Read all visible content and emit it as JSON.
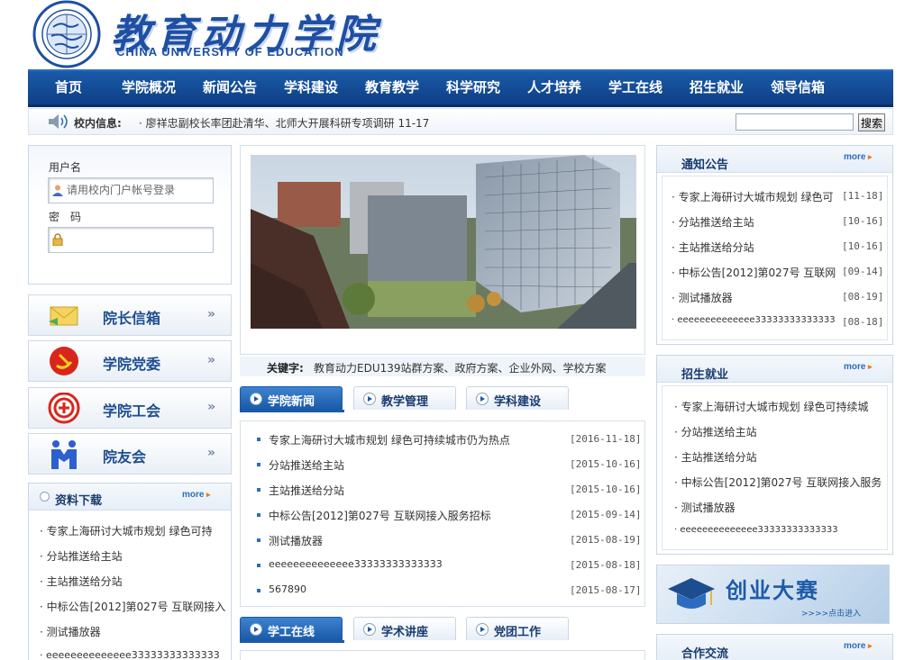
{
  "header": {
    "logo_cn": "教育动力学院",
    "logo_en": "CHINA UNIVERSITY OF EDUCATION"
  },
  "nav": {
    "items": [
      "首页",
      "学院概况",
      "新闻公告",
      "学科建设",
      "教育教学",
      "科学研究",
      "人才培养",
      "学工在线",
      "招生就业",
      "领导信箱"
    ]
  },
  "infobar": {
    "label": "校内信息:",
    "text": "· 廖祥忠副校长率团赴清华、北师大开展科研专项调研 11-17",
    "search_value": "",
    "search_button": "搜索"
  },
  "login": {
    "username_label": "用户名",
    "username_placeholder": "请用校内门户帐号登录",
    "password_label": "密　码"
  },
  "side_buttons": [
    {
      "label": "院长信箱",
      "icon": "mail-icon"
    },
    {
      "label": "学院党委",
      "icon": "party-emblem-icon"
    },
    {
      "label": "学院工会",
      "icon": "union-emblem-icon"
    },
    {
      "label": "院友会",
      "icon": "handshake-icon"
    }
  ],
  "downloads": {
    "title": "资料下载",
    "more": "more",
    "items": [
      "专家上海研讨大城市规划 绿色可持",
      "分站推送给主站",
      "主站推送给分站",
      "中标公告[2012]第027号 互联网接入",
      "测试播放器",
      "eeeeeeeeeeeeee33333333333333"
    ]
  },
  "keywords": {
    "label": "关键字:",
    "text": "教育动力EDU139站群方案、政府方案、企业外网、学校方案"
  },
  "tabs1": [
    "学院新闻",
    "教学管理",
    "学科建设"
  ],
  "news": [
    {
      "title": "专家上海研讨大城市规划 绿色可持续城市仍为热点",
      "date": "[2016-11-18]"
    },
    {
      "title": "分站推送给主站",
      "date": "[2015-10-16]"
    },
    {
      "title": "主站推送给分站",
      "date": "[2015-10-16]"
    },
    {
      "title": "中标公告[2012]第027号 互联网接入服务招标",
      "date": "[2015-09-14]"
    },
    {
      "title": "测试播放器",
      "date": "[2015-08-19]"
    },
    {
      "title": "eeeeeeeeeeeeee33333333333333",
      "date": "[2015-08-18]"
    },
    {
      "title": "567890",
      "date": "[2015-08-17]"
    }
  ],
  "tabs2": [
    "学工在线",
    "学术讲座",
    "党团工作"
  ],
  "notices": {
    "title": "通知公告",
    "more": "more",
    "items": [
      {
        "title": "专家上海研讨大城市规划 绿色可",
        "date": "[11-18]"
      },
      {
        "title": "分站推送给主站",
        "date": "[10-16]"
      },
      {
        "title": "主站推送给分站",
        "date": "[10-16]"
      },
      {
        "title": "中标公告[2012]第027号 互联网",
        "date": "[09-14]"
      },
      {
        "title": "测试播放器",
        "date": "[08-19]"
      },
      {
        "title": "eeeeeeeeeeeeee33333333333333",
        "date": "[08-18]"
      }
    ]
  },
  "employment": {
    "title": "招生就业",
    "more": "more",
    "items": [
      "专家上海研讨大城市规划 绿色可持续城",
      "分站推送给主站",
      "主站推送给分站",
      "中标公告[2012]第027号 互联网接入服务",
      "测试播放器",
      "eeeeeeeeeeeeee33333333333333"
    ]
  },
  "promo": {
    "title": "创业大赛",
    "sub": ">>>>点击进入"
  },
  "cooperation": {
    "title": "合作交流",
    "more": "more"
  },
  "colors": {
    "nav_blue": "#1a5aa8",
    "link_blue": "#2c6cc0",
    "title_dark": "#1a3c6e"
  }
}
